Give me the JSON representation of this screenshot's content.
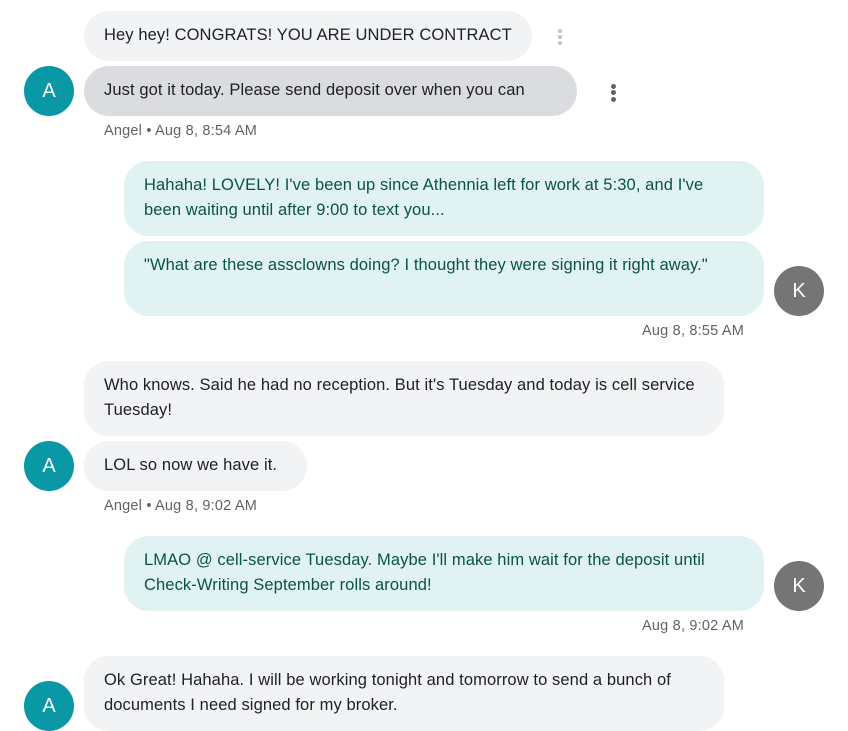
{
  "messages": [
    {
      "text": "Hey hey!  CONGRATS! YOU ARE UNDER CONTRACT"
    },
    {
      "text": "Just got it today. Please send deposit over when you can"
    },
    {
      "text": "Hahaha! LOVELY! I've been up since Athennia left for work at 5:30, and I've been waiting until after 9:00 to text you..."
    },
    {
      "text": "\"What are these assclowns doing? I thought they were signing it right away.\""
    },
    {
      "text": "Who knows. Said he had no reception.  But it's Tuesday and today is cell service Tuesday!"
    },
    {
      "text": "LOL so now we have it."
    },
    {
      "text": "LMAO @ cell-service Tuesday. Maybe I'll make him wait for the deposit until Check-Writing September rolls around!"
    },
    {
      "text": "Ok Great!  Hahaha. I will be working tonight and tomorrow to send a bunch of documents I need signed for my broker."
    }
  ],
  "meta": [
    {
      "sender": "Angel",
      "sep": "•",
      "time": "Aug 8, 8:54 AM"
    },
    {
      "time": "Aug 8, 8:55 AM"
    },
    {
      "sender": "Angel",
      "sep": "•",
      "time": "Aug 8, 9:02 AM"
    },
    {
      "time": "Aug 8, 9:02 AM"
    }
  ],
  "avatars": {
    "angel_initial": "A",
    "k_initial": "K",
    "angel_color": "#0a97a6",
    "k_color": "#757575"
  },
  "colors": {
    "incoming_bubble": "#f1f3f4",
    "selected_bubble": "#dadce0",
    "outgoing_bubble": "#e0f2f1",
    "outgoing_text": "#0b5345"
  },
  "icons": {
    "message_menu": "more-vert-icon"
  }
}
